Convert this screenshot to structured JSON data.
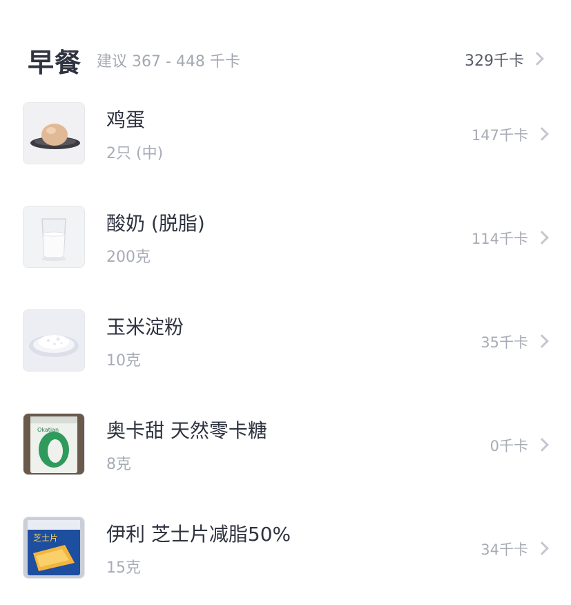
{
  "meal": {
    "title": "早餐",
    "suggestion": "建议 367 - 448 千卡",
    "total": "329千卡"
  },
  "items": [
    {
      "name": "鸡蛋",
      "amount": "2只 (中)",
      "kcal": "147千卡",
      "thumb_icon": "egg-on-plate"
    },
    {
      "name": "酸奶 (脱脂)",
      "amount": "200克",
      "kcal": "114千卡",
      "thumb_icon": "glass-of-yogurt"
    },
    {
      "name": "玉米淀粉",
      "amount": "10克",
      "kcal": "35千卡",
      "thumb_icon": "plate-of-starch"
    },
    {
      "name": "奥卡甜 天然零卡糖",
      "amount": "8克",
      "kcal": "0千卡",
      "thumb_icon": "sweetener-package",
      "thumb_text": "Okatian"
    },
    {
      "name": "伊利 芝士片减脂50%",
      "amount": "15克",
      "kcal": "34千卡",
      "thumb_icon": "cheese-slice-package",
      "thumb_text": "芝士片"
    }
  ],
  "colors": {
    "title": "#2f3340",
    "muted": "#a7abb5",
    "chevron": "#c4c7cf"
  }
}
